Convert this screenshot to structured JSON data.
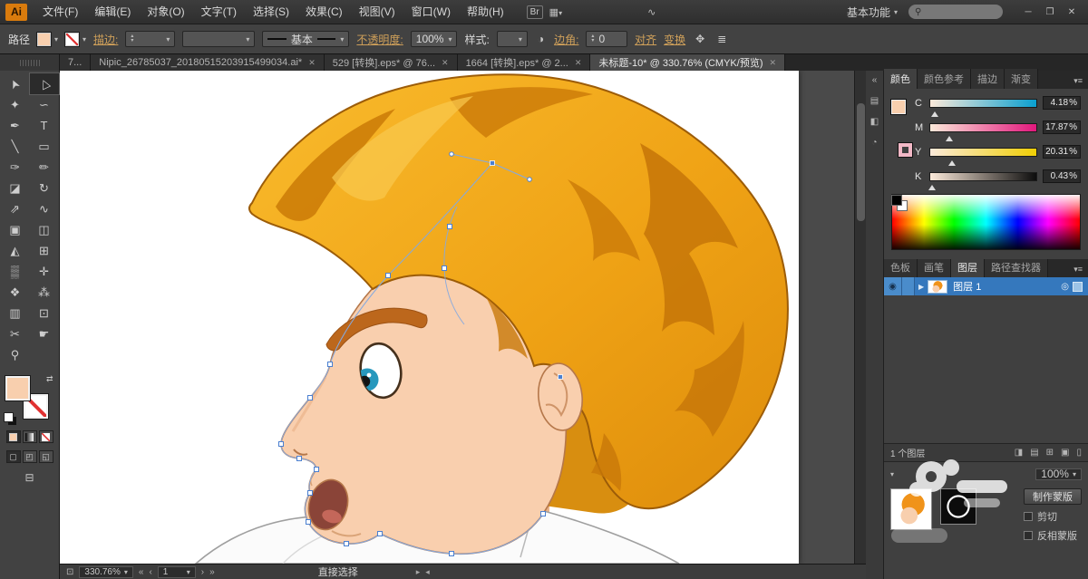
{
  "titlebar": {
    "logo": "Ai",
    "menus": [
      "文件(F)",
      "编辑(E)",
      "对象(O)",
      "文字(T)",
      "选择(S)",
      "效果(C)",
      "视图(V)",
      "窗口(W)",
      "帮助(H)"
    ],
    "bridge_label": "Br",
    "workspace_label": "基本功能",
    "search_placeholder": ""
  },
  "controlbar": {
    "object_label": "路径",
    "stroke_link": "描边:",
    "profile_label": "基本",
    "opacity_link": "不透明度:",
    "opacity_value": "100%",
    "style_label": "样式:",
    "corner_link": "边角:",
    "corner_value": "0",
    "align_link": "对齐",
    "transform_link": "变换"
  },
  "tabs": [
    {
      "label": "7...",
      "active": false,
      "closable": false
    },
    {
      "label": "Nipic_26785037_20180515203915499034.ai*",
      "active": false,
      "closable": true
    },
    {
      "label": "529 [转换].eps* @ 76...",
      "active": false,
      "closable": true
    },
    {
      "label": "1664 [转换].eps* @ 2...",
      "active": false,
      "closable": true
    },
    {
      "label": "未标题-10* @ 330.76% (CMYK/预览)",
      "active": true,
      "closable": true
    }
  ],
  "tools": [
    {
      "name": "selection-tool",
      "glyph": "➤",
      "rotate": -115
    },
    {
      "name": "direct-selection-tool",
      "glyph": "▷",
      "rotate": -115,
      "active": true
    },
    {
      "name": "magic-wand-tool",
      "glyph": "✦"
    },
    {
      "name": "lasso-tool",
      "glyph": "∽"
    },
    {
      "name": "pen-tool",
      "glyph": "✒"
    },
    {
      "name": "type-tool",
      "glyph": "T"
    },
    {
      "name": "line-tool",
      "glyph": "╲"
    },
    {
      "name": "rectangle-tool",
      "glyph": "▭"
    },
    {
      "name": "paintbrush-tool",
      "glyph": "✑"
    },
    {
      "name": "pencil-tool",
      "glyph": "✏"
    },
    {
      "name": "eraser-tool",
      "glyph": "◪"
    },
    {
      "name": "rotate-tool",
      "glyph": "↻"
    },
    {
      "name": "scale-tool",
      "glyph": "⇗"
    },
    {
      "name": "width-tool",
      "glyph": "∿"
    },
    {
      "name": "free-transform-tool",
      "glyph": "▣"
    },
    {
      "name": "shape-builder-tool",
      "glyph": "◫"
    },
    {
      "name": "perspective-grid-tool",
      "glyph": "◭"
    },
    {
      "name": "mesh-tool",
      "glyph": "⊞"
    },
    {
      "name": "gradient-tool",
      "glyph": "▒"
    },
    {
      "name": "eyedropper-tool",
      "glyph": "✛"
    },
    {
      "name": "blend-tool",
      "glyph": "❖"
    },
    {
      "name": "symbol-sprayer-tool",
      "glyph": "⁂"
    },
    {
      "name": "column-graph-tool",
      "glyph": "▥"
    },
    {
      "name": "artboard-tool",
      "glyph": "⊡"
    },
    {
      "name": "slice-tool",
      "glyph": "✂"
    },
    {
      "name": "hand-tool",
      "glyph": "☛"
    },
    {
      "name": "zoom-tool",
      "glyph": "⚲"
    }
  ],
  "color_panel": {
    "tabs": [
      "颜色",
      "颜色参考",
      "描边",
      "渐变"
    ],
    "active_tab": "颜色",
    "channels": [
      {
        "label": "C",
        "value": "4.18",
        "unit": "%"
      },
      {
        "label": "M",
        "value": "17.87",
        "unit": "%"
      },
      {
        "label": "Y",
        "value": "20.31",
        "unit": "%"
      },
      {
        "label": "K",
        "value": "0.43",
        "unit": "%"
      }
    ],
    "fill_color": "#f8cfae",
    "stroke_color": "#f2b8c6"
  },
  "layers_panel": {
    "tabs": [
      "色板",
      "画笔",
      "图层",
      "路径查找器"
    ],
    "active_tab": "图层",
    "layers": [
      {
        "name": "图层 1",
        "selected": true
      }
    ],
    "status": "1 个图层"
  },
  "transparency_panel": {
    "opacity_value": "100%",
    "make_mask_label": "制作蒙版",
    "clip_label": "剪切",
    "invert_label": "反相蒙版"
  },
  "statusbar": {
    "zoom": "330.76%",
    "artboard": "1",
    "tool_name": "直接选择"
  },
  "icons": {
    "close": "✕",
    "minimize": "─",
    "restore": "❐",
    "search": "⚲",
    "dropdown": "▾",
    "dropup": "▴",
    "menu": "≡",
    "layout": "▦",
    "wave": "∿",
    "recolor": "◑",
    "align_glyph": "✥",
    "settings": "≣",
    "tri_right": "▸",
    "tri_left": "◂",
    "nav_first": "«",
    "nav_prev": "‹",
    "nav_next": "›",
    "nav_last": "»",
    "eye": "◉",
    "target": "◎",
    "expand": "▶",
    "swap": "⇄",
    "strip1": "«",
    "strip2": "▤",
    "strip3": "◧",
    "strip4": "◔",
    "lf1": "◨",
    "lf2": "▤",
    "lf3": "⊞",
    "lf4": "▣",
    "lf5": "▯",
    "sb_artboard": "⊡",
    "mode1": "▢",
    "mode2": "◰",
    "mode3": "◱",
    "screen": "⊟"
  }
}
